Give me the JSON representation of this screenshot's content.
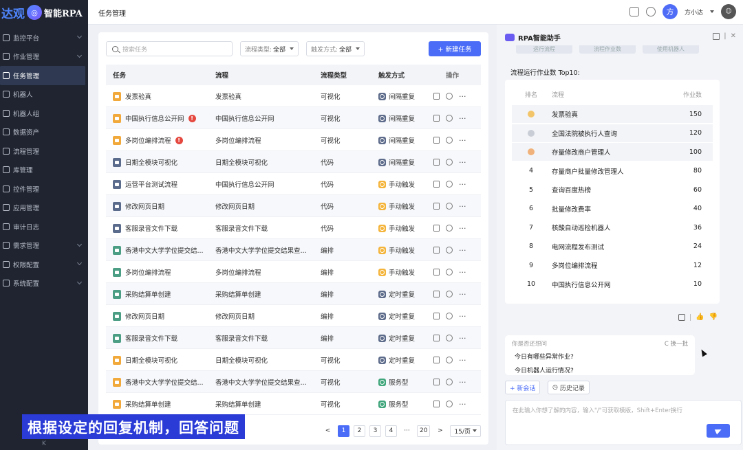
{
  "brand": {
    "part1": "达观",
    "logo_glyph": "◎",
    "part2": "智能RPA"
  },
  "sidebar": {
    "items": [
      {
        "label": "监控平台",
        "expandable": true
      },
      {
        "label": "作业管理",
        "expandable": true
      },
      {
        "label": "任务管理",
        "expandable": false,
        "active": true
      },
      {
        "label": "机器人",
        "expandable": false
      },
      {
        "label": "机器人组",
        "expandable": false
      },
      {
        "label": "数据资产",
        "expandable": false
      },
      {
        "label": "流程管理",
        "expandable": false
      },
      {
        "label": "库管理",
        "expandable": false
      },
      {
        "label": "控件管理",
        "expandable": false
      },
      {
        "label": "应用管理",
        "expandable": false
      },
      {
        "label": "审计日志",
        "expandable": false
      },
      {
        "label": "需求管理",
        "expandable": true
      },
      {
        "label": "权限配置",
        "expandable": true
      },
      {
        "label": "系统配置",
        "expandable": true
      }
    ],
    "collapse_glyph": "K"
  },
  "header": {
    "title": "任务管理",
    "avatar_text": "方",
    "user_name": "方小达",
    "robot_text": "☺"
  },
  "toolbar": {
    "search_placeholder": "搜索任务",
    "flow_type_label": "流程类型:",
    "flow_type_value": "全部",
    "trigger_label": "触发方式:",
    "trigger_value": "全部",
    "new_button": "+ 新建任务"
  },
  "table": {
    "headers": {
      "task": "任务",
      "flow": "流程",
      "type": "流程类型",
      "trigger": "触发方式",
      "ops": "操作"
    },
    "rows": [
      {
        "task": "发票验真",
        "flow": "发票验真",
        "type": "可视化",
        "trigger": "间隔重复",
        "icon": "visual",
        "trig": "interval",
        "warn": false
      },
      {
        "task": "中国执行信息公开网",
        "flow": "中国执行信息公开网",
        "type": "可视化",
        "trigger": "间隔重复",
        "icon": "visual",
        "trig": "interval",
        "warn": true
      },
      {
        "task": "多岗位编排流程",
        "flow": "多岗位编排流程",
        "type": "可视化",
        "trigger": "间隔重复",
        "icon": "visual",
        "trig": "interval",
        "warn": true
      },
      {
        "task": "日期全模块可视化",
        "flow": "日期全模块可视化",
        "type": "代码",
        "trigger": "间隔重复",
        "icon": "code",
        "trig": "interval",
        "warn": false
      },
      {
        "task": "运营平台测试流程",
        "flow": "中国执行信息公开网",
        "type": "代码",
        "trigger": "手动触发",
        "icon": "code",
        "trig": "manual",
        "warn": false
      },
      {
        "task": "修改网页日期",
        "flow": "修改网页日期",
        "type": "代码",
        "trigger": "手动触发",
        "icon": "code",
        "trig": "manual",
        "warn": false
      },
      {
        "task": "客服录音文件下载",
        "flow": "客服录音文件下载",
        "type": "代码",
        "trigger": "手动触发",
        "icon": "code",
        "trig": "manual",
        "warn": false
      },
      {
        "task": "香港中文大学学位提交结...",
        "flow": "香港中文大学学位提交结果查...",
        "type": "编排",
        "trigger": "手动触发",
        "icon": "arrange",
        "trig": "manual",
        "warn": false
      },
      {
        "task": "多岗位编排流程",
        "flow": "多岗位编排流程",
        "type": "编排",
        "trigger": "手动触发",
        "icon": "arrange",
        "trig": "manual",
        "warn": false
      },
      {
        "task": "采购结算单创建",
        "flow": "采购结算单创建",
        "type": "编排",
        "trigger": "定时重复",
        "icon": "arrange",
        "trig": "timed",
        "warn": false
      },
      {
        "task": "修改网页日期",
        "flow": "修改网页日期",
        "type": "编排",
        "trigger": "定时重复",
        "icon": "arrange",
        "trig": "timed",
        "warn": false
      },
      {
        "task": "客服录音文件下载",
        "flow": "客服录音文件下载",
        "type": "编排",
        "trigger": "定时重复",
        "icon": "arrange",
        "trig": "timed",
        "warn": false
      },
      {
        "task": "日期全模块可视化",
        "flow": "日期全模块可视化",
        "type": "可视化",
        "trigger": "定时重复",
        "icon": "visual",
        "trig": "timed",
        "warn": false
      },
      {
        "task": "香港中文大学学位提交结...",
        "flow": "香港中文大学学位提交结果查...",
        "type": "可视化",
        "trigger": "服务型",
        "icon": "visual",
        "trig": "service",
        "warn": false
      },
      {
        "task": "采购结算单创建",
        "flow": "采购结算单创建",
        "type": "可视化",
        "trigger": "服务型",
        "icon": "visual",
        "trig": "service",
        "warn": false
      }
    ]
  },
  "pagination": {
    "prev": "<",
    "pages": [
      "1",
      "2",
      "3",
      "4",
      "···",
      "20"
    ],
    "current": "1",
    "next": ">",
    "page_size": "15/页"
  },
  "caption": "根据设定的回复机制，回答问题",
  "assistant": {
    "title": "RPA智能助手",
    "tabs": [
      "运行流程",
      "流程作业数",
      "使用机器人"
    ],
    "top10_title": "流程运行作业数 Top10:",
    "rank_headers": {
      "rank": "排名",
      "flow": "流程",
      "count": "作业数"
    },
    "ranking": [
      {
        "rank": "1",
        "flow": "发票验真",
        "count": "150"
      },
      {
        "rank": "2",
        "flow": "全国法院被执行人查询",
        "count": "120"
      },
      {
        "rank": "3",
        "flow": "存量修改商户管理人",
        "count": "100"
      },
      {
        "rank": "4",
        "flow": "存量商户批量修改管理人",
        "count": "80"
      },
      {
        "rank": "5",
        "flow": "查询百度热榜",
        "count": "60"
      },
      {
        "rank": "6",
        "flow": "批量修改费率",
        "count": "40"
      },
      {
        "rank": "7",
        "flow": "核酸自动巡检机器人",
        "count": "36"
      },
      {
        "rank": "8",
        "flow": "电网流程发布测试",
        "count": "24"
      },
      {
        "rank": "9",
        "flow": "多岗位编排流程",
        "count": "12"
      },
      {
        "rank": "10",
        "flow": "中国执行信息公开网",
        "count": "10"
      }
    ],
    "suggest_title": "你是否还想问",
    "refresh": "C 换一批",
    "questions": [
      "今日有哪些异常作业?",
      "今日机器人运行情况?"
    ],
    "new_session": "+ 新会话",
    "history": "历史记录",
    "input_placeholder": "在此输入你想了解的内容，输入\"/\"可获取模版，Shift+Enter换行"
  }
}
